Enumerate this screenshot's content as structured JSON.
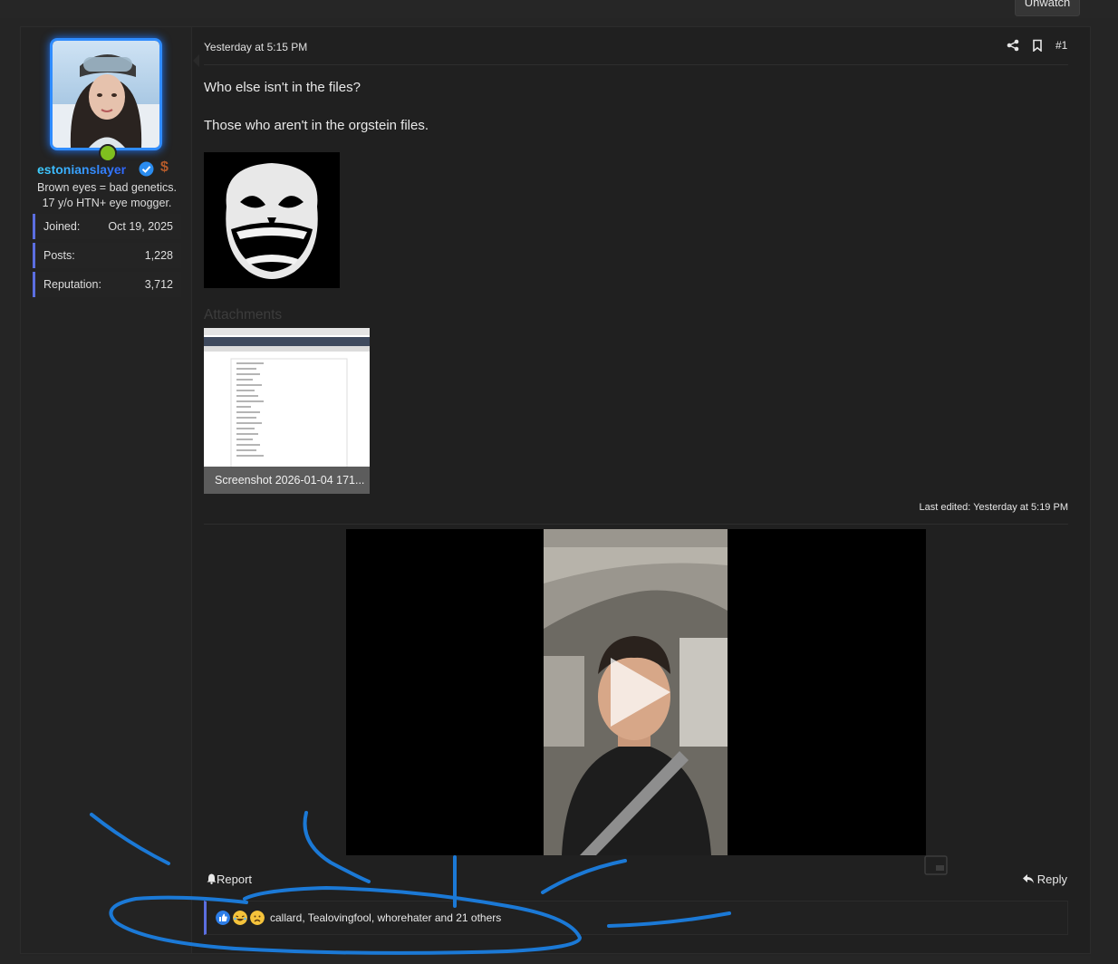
{
  "header": {
    "watch_button_label": "Unwatch"
  },
  "user": {
    "name": "estonianslayer",
    "title": "Brown eyes = bad genetics. 17 y/o HTN+ eye mogger.",
    "stats": [
      {
        "label": "Joined:",
        "value": "Oct 19, 2025"
      },
      {
        "label": "Posts:",
        "value": "1,228"
      },
      {
        "label": "Reputation:",
        "value": "3,712"
      }
    ],
    "status": "online",
    "avatar_border_color": "#2f8cff",
    "online_color": "#7fbf1f"
  },
  "post": {
    "date": "Yesterday at 5:15 PM",
    "number": "#1",
    "lines": [
      "Who else isn't in the files?",
      "Those who aren't in the orgstein files."
    ],
    "attachments_title": "Attachments",
    "attachment_caption": "Screenshot 2026-01-04 171...",
    "last_edited": "Last edited: Yesterday at 5:19 PM",
    "report_label": "Report",
    "reply_label": "Reply",
    "reactions_text": "callard, Tealovingfool, whorehater and 21 others"
  },
  "icons": {
    "share": "share-icon",
    "bookmark": "bookmark-icon",
    "report": "bell-icon",
    "reply": "reply-arrow-icon",
    "reactions": [
      "like-icon",
      "laugh-icon",
      "sad-icon"
    ]
  },
  "colors": {
    "background": "#252525",
    "post_bg": "#202020",
    "accent": "#5b6ee0",
    "annotation_stroke": "#1b79d6"
  }
}
